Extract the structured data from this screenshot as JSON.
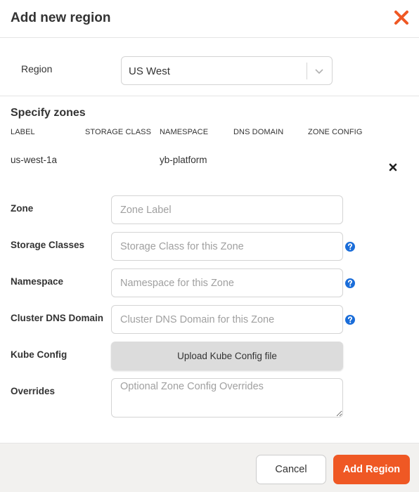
{
  "dialog": {
    "title": "Add new region",
    "close_icon": "close-x-icon",
    "accent_color": "#ef5824"
  },
  "region": {
    "label": "Region",
    "selected": "US West",
    "chevron_icon": "chevron-down-icon"
  },
  "zones": {
    "title": "Specify zones",
    "columns": [
      "LABEL",
      "STORAGE CLASS",
      "NAMESPACE",
      "DNS DOMAIN",
      "ZONE CONFIG"
    ],
    "rows": [
      {
        "label": "us-west-1a",
        "storage_class": "",
        "namespace": "yb-platform",
        "dns_domain": "",
        "zone_config": ""
      }
    ],
    "delete_icon": "delete-x-icon"
  },
  "form": {
    "zone": {
      "label": "Zone",
      "placeholder": "Zone Label"
    },
    "storage_classes": {
      "label": "Storage Classes",
      "placeholder": "Storage Class for this Zone"
    },
    "namespace": {
      "label": "Namespace",
      "placeholder": "Namespace for this Zone"
    },
    "cluster_dns": {
      "label": "Cluster DNS Domain",
      "placeholder": "Cluster DNS Domain for this Zone"
    },
    "kube_config": {
      "label": "Kube Config",
      "button": "Upload Kube Config file"
    },
    "overrides": {
      "label": "Overrides",
      "placeholder": "Optional Zone Config Overrides"
    },
    "help_icon": "question-circle-icon",
    "help_color": "#1a6dd9"
  },
  "footer": {
    "cancel": "Cancel",
    "submit": "Add Region"
  }
}
